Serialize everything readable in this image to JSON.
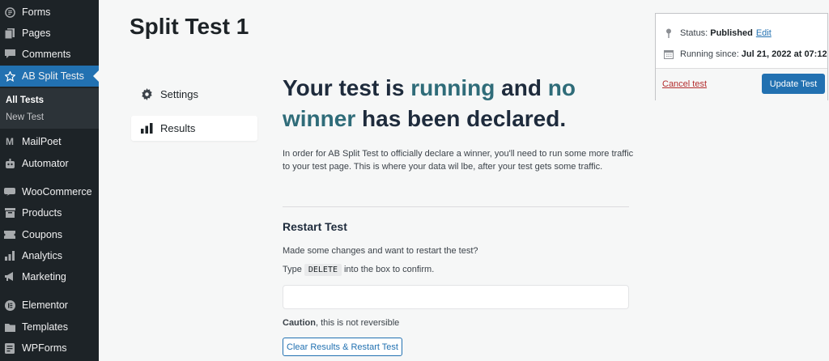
{
  "sidebar": {
    "items": [
      {
        "label": "Forms",
        "icon": "forms-icon"
      },
      {
        "label": "Pages",
        "icon": "pages-icon"
      },
      {
        "label": "Comments",
        "icon": "comments-icon"
      },
      {
        "label": "AB Split Tests",
        "icon": "star-icon",
        "active": true
      },
      {
        "label": "MailPoet",
        "icon": "mailpoet-icon"
      },
      {
        "label": "Automator",
        "icon": "automator-icon"
      },
      {
        "label": "WooCommerce",
        "icon": "woocommerce-icon"
      },
      {
        "label": "Products",
        "icon": "products-icon"
      },
      {
        "label": "Coupons",
        "icon": "coupons-icon"
      },
      {
        "label": "Analytics",
        "icon": "analytics-icon"
      },
      {
        "label": "Marketing",
        "icon": "megaphone-icon"
      },
      {
        "label": "Elementor",
        "icon": "elementor-icon"
      },
      {
        "label": "Templates",
        "icon": "folder-icon"
      },
      {
        "label": "WPForms",
        "icon": "wpforms-icon"
      }
    ],
    "submenu": [
      {
        "label": "All Tests",
        "current": true
      },
      {
        "label": "New Test"
      }
    ]
  },
  "page": {
    "title": "Split Test 1"
  },
  "tabs": [
    {
      "label": "Settings",
      "icon": "gear-icon"
    },
    {
      "label": "Results",
      "icon": "bar-chart-icon",
      "selected": true
    }
  ],
  "main": {
    "headline_1": "Your test is ",
    "headline_hl_1": "running",
    "headline_2": " and ",
    "headline_hl_2": "no winner",
    "headline_3": " has been declared.",
    "description": "In order for AB Split Test to officially declare a winner, you'll need to run some more traffic to your test page. This is where your data wil lbe, after your test gets some traffic.",
    "restart_title": "Restart Test",
    "restart_prompt": "Made some changes and want to restart the test?",
    "type_prefix": "Type",
    "type_code": "DELETE",
    "type_suffix": "into the box to confirm.",
    "confirm_value": "",
    "caution_bold": "Caution",
    "caution_rest": ", this is not reversible",
    "restart_button": "Clear Results & Restart Test"
  },
  "publish": {
    "status_label": "Status:",
    "status_value": "Published",
    "edit_link": "Edit",
    "running_label": "Running since:",
    "running_value": "Jul 21, 2022 at 07:12",
    "cancel_link": "Cancel test",
    "update_button": "Update Test"
  },
  "colors": {
    "sidebar_bg": "#1d2327",
    "accent": "#2271b1",
    "highlight_text": "#2f6c79",
    "danger": "#b32d2e"
  }
}
